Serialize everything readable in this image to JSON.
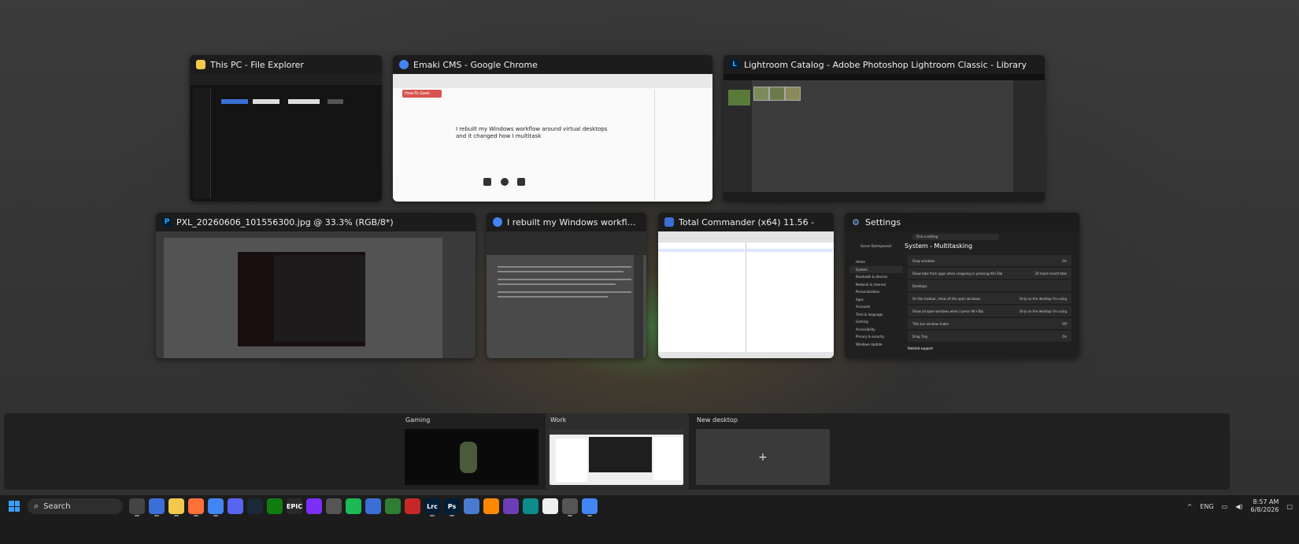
{
  "windows": [
    {
      "title": "This PC - File Explorer",
      "icon": "folder-icon",
      "color": "#f2c94c"
    },
    {
      "title": "Emaki CMS - Google Chrome",
      "icon": "chrome-icon",
      "color": "#4285f4"
    },
    {
      "title": "Lightroom Catalog - Adobe Photoshop Lightroom Classic - Library",
      "icon": "lightroom-icon",
      "color": "#31a8ff"
    },
    {
      "title": "PXL_20260606_101556300.jpg @ 33.3% (RGB/8*)",
      "icon": "photoshop-icon",
      "color": "#31a8ff"
    },
    {
      "title": "I rebuilt my Windows workflow around virtual des...",
      "icon": "chrome-icon",
      "color": "#4285f4"
    },
    {
      "title": "Total Commander (x64) 11.56 -",
      "icon": "total-commander-icon",
      "color": "#3b6fd6"
    },
    {
      "title": "Settings",
      "icon": "gear-icon",
      "color": "#8ab4f8"
    }
  ],
  "chrome_article": {
    "heading_line1": "I rebuilt my Windows workflow around virtual desktops",
    "heading_line2": "and it changed how I multitask",
    "logo": "How-To Geek"
  },
  "settings": {
    "breadcrumb_root": "System",
    "breadcrumb_sep": "›",
    "breadcrumb_page": "Multitasking",
    "search_placeholder": "Find a setting",
    "user": "Goran Damnjanović",
    "nav": [
      "Home",
      "System",
      "Bluetooth & devices",
      "Network & internet",
      "Personalization",
      "Apps",
      "Accounts",
      "Time & language",
      "Gaming",
      "Accessibility",
      "Privacy & security",
      "Windows Update"
    ],
    "rows": [
      {
        "label": "Snap windows",
        "value": "On"
      },
      {
        "label": "Show tabs from apps when snapping or pressing Alt+Tab",
        "value": "20 most recent tabs"
      },
      {
        "label": "Desktops",
        "value": ""
      },
      {
        "label": "On the taskbar, show all the open windows",
        "value": "Only on the desktop I'm using"
      },
      {
        "label": "Show all open windows when I press Alt+Tab",
        "value": "Only on the desktop I'm using"
      },
      {
        "label": "Title bar window shake",
        "value": "Off"
      },
      {
        "label": "Drag Tray",
        "value": "On"
      }
    ],
    "related": "Related support"
  },
  "desktops": [
    {
      "label": "Gaming"
    },
    {
      "label": "Work"
    },
    {
      "label": "New desktop",
      "plus": "+"
    }
  ],
  "taskbar": {
    "search_placeholder": "Search",
    "apps": [
      {
        "name": "task-view-icon",
        "label": "",
        "color": "#444"
      },
      {
        "name": "save-icon",
        "label": "",
        "color": "#3b6fd6"
      },
      {
        "name": "file-explorer-icon",
        "label": "",
        "color": "#f2c94c"
      },
      {
        "name": "firefox-icon",
        "label": "",
        "color": "#ff7139"
      },
      {
        "name": "chrome-icon",
        "label": "",
        "color": "#4285f4"
      },
      {
        "name": "app-diamond-icon",
        "label": "",
        "color": "#5865f2"
      },
      {
        "name": "steam-icon",
        "label": "",
        "color": "#1b2838"
      },
      {
        "name": "xbox-icon",
        "label": "",
        "color": "#107c10"
      },
      {
        "name": "epic-games-icon",
        "label": "EPIC",
        "color": "#2a2a2a"
      },
      {
        "name": "app-circle-icon",
        "label": "",
        "color": "#7b2ff7"
      },
      {
        "name": "app-ring-icon",
        "label": "",
        "color": "#555"
      },
      {
        "name": "spotify-icon",
        "label": "",
        "color": "#1db954"
      },
      {
        "name": "app-bars-icon",
        "label": "",
        "color": "#3b6fd6"
      },
      {
        "name": "app-x-icon",
        "label": "",
        "color": "#2e7d32"
      },
      {
        "name": "app-red-icon",
        "label": "",
        "color": "#c62828"
      },
      {
        "name": "lightroom-icon",
        "label": "Lrc",
        "color": "#001e36"
      },
      {
        "name": "photoshop-icon",
        "label": "Ps",
        "color": "#001e36"
      },
      {
        "name": "app-globe-icon",
        "label": "",
        "color": "#4a7bd0"
      },
      {
        "name": "vlc-icon",
        "label": "",
        "color": "#ff8800"
      },
      {
        "name": "app-purple-icon",
        "label": "",
        "color": "#6a3fb5"
      },
      {
        "name": "app-teal-icon",
        "label": "",
        "color": "#0e8c8c"
      },
      {
        "name": "calendar-icon",
        "label": "",
        "color": "#eeeeee"
      },
      {
        "name": "settings-icon",
        "label": "",
        "color": "#555"
      },
      {
        "name": "chrome-alt-icon",
        "label": "",
        "color": "#4285f4"
      }
    ],
    "tray": {
      "chevron": "^",
      "lang": "ENG",
      "time": "8:57 AM",
      "date": "6/8/2026"
    }
  }
}
